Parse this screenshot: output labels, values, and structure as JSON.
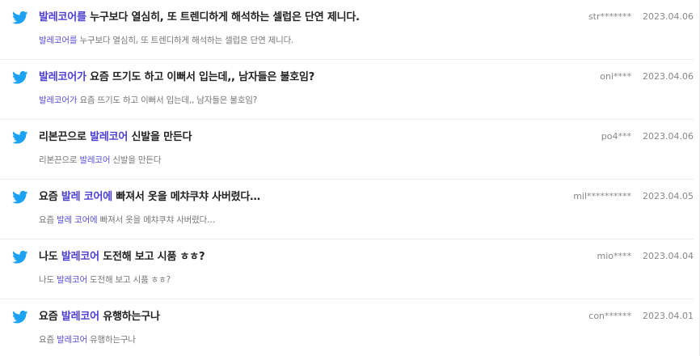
{
  "accent_color": "#4b3fd1",
  "icon_color": "#1da1f2",
  "results": [
    {
      "icon": "twitter-bird-icon",
      "title_hl": "발레코어를",
      "title_rest": " 누구보다 열심히, 또 트렌디하게 해석하는 셀럽은 단연 제니다.",
      "snippet_hl": "발레코어를",
      "snippet_rest": " 누구보다 열심히, 또 트렌디하게 해석하는 셀럽은 단연 제니다.",
      "user": "str*******",
      "date": "2023.04.06"
    },
    {
      "icon": "twitter-bird-icon",
      "title_hl": "발레코어가",
      "title_rest": " 요즘 뜨기도 하고 이뻐서 입는데,, 남자들은 불호임?",
      "snippet_hl": "발레코어가",
      "snippet_rest": " 요즘 뜨기도 하고 이뻐서 입는데,, 남자들은 불호임?",
      "user": "oni****",
      "date": "2023.04.06"
    },
    {
      "icon": "twitter-bird-icon",
      "title_pre": "리본끈으로 ",
      "title_hl": "발레코어",
      "title_rest": " 신발을 만든다",
      "snippet_pre": "리본끈으로 ",
      "snippet_hl": "발레코어",
      "snippet_rest": " 신발을 만든다",
      "user": "po4***",
      "date": "2023.04.06"
    },
    {
      "icon": "twitter-bird-icon",
      "title_pre": "요즘 ",
      "title_hl": "발레 코어에",
      "title_rest": " 빠져서 옷을 메챠쿠챠 사버렸다…",
      "snippet_pre": "요즘 ",
      "snippet_hl": "발레 코어에",
      "snippet_rest": " 빠져서 옷을 메챠쿠챠 사버렸다…",
      "user": "mil**********",
      "date": "2023.04.05"
    },
    {
      "icon": "twitter-bird-icon",
      "title_pre": "나도 ",
      "title_hl": "발레코어",
      "title_rest": " 도전해 보고 시품 ㅎㅎ?",
      "snippet_pre": "나도 ",
      "snippet_hl": "발레코어",
      "snippet_rest": " 도전해 보고 시품 ㅎㅎ?",
      "user": "mio****",
      "date": "2023.04.04"
    },
    {
      "icon": "twitter-bird-icon",
      "title_pre": "요즘 ",
      "title_hl": "발레코어",
      "title_rest": " 유행하는구나",
      "snippet_pre": "요즘 ",
      "snippet_hl": "발레코어",
      "snippet_rest": " 유행하는구나",
      "user": "con******",
      "date": "2023.04.01"
    }
  ]
}
